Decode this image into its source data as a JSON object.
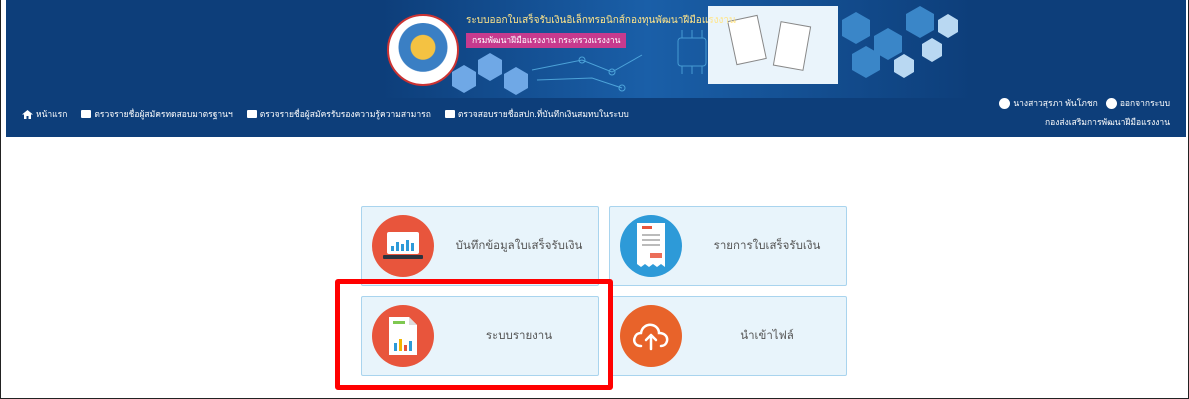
{
  "header": {
    "banner_title": "ระบบออกใบเสร็จรับเงินอิเล็กทรอนิกส์กองทุนพัฒนาฝีมือแรงงาน",
    "banner_subtitle": "กรมพัฒนาฝีมือแรงงาน กระทรวงแรงงาน",
    "accent_color": "#0d3e7a"
  },
  "nav": {
    "items": [
      {
        "label": "หน้าแรก",
        "icon": "home-icon"
      },
      {
        "label": "ตรวจรายชื่อผู้สมัครทดสอบมาตรฐานฯ",
        "icon": "list-icon"
      },
      {
        "label": "ตรวจรายชื่อผู้สมัครรับรองความรู้ความสามารถ",
        "icon": "list-icon"
      },
      {
        "label": "ตรวจสอบรายชื่อสปก.ที่บันทึกเงินสมทบในระบบ",
        "icon": "list-icon"
      }
    ]
  },
  "user": {
    "name": "นางสาวสุรภา พันโภชก",
    "logout_label": "ออกจากระบบ",
    "department": "กองส่งเสริมการพัฒนาฝีมือแรงงาน"
  },
  "tiles": [
    {
      "label": "บันทึกข้อมูลใบเสร็จรับเงิน",
      "icon": "laptop-chart-icon",
      "color": "#e8553c"
    },
    {
      "label": "รายการใบเสร็จรับเงิน",
      "icon": "receipt-icon",
      "color": "#2d9ad8"
    },
    {
      "label": "ระบบรายงาน",
      "icon": "report-icon",
      "color": "#e8553c"
    },
    {
      "label": "นำเข้าไฟล์",
      "icon": "cloud-upload-icon",
      "color": "#e8632a"
    }
  ],
  "highlight_color": "#ff0000"
}
